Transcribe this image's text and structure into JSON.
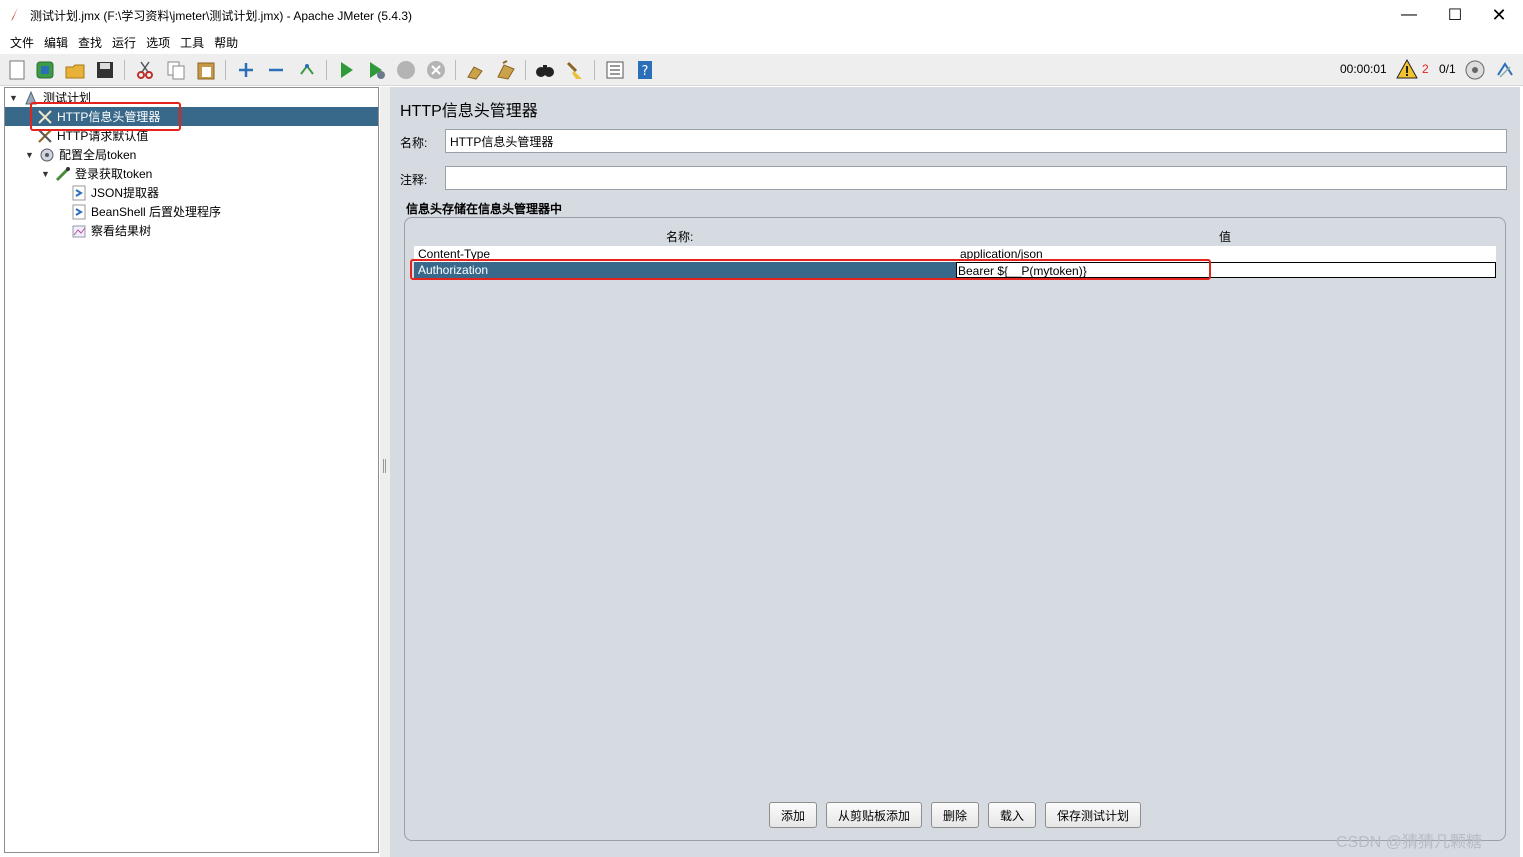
{
  "window": {
    "title": "测试计划.jmx (F:\\学习资料\\jmeter\\测试计划.jmx) - Apache JMeter (5.4.3)",
    "minimize_glyph": "—",
    "maximize_glyph": "☐",
    "close_glyph": "✕"
  },
  "menu": [
    "文件",
    "编辑",
    "查找",
    "运行",
    "选项",
    "工具",
    "帮助"
  ],
  "toolbar": {
    "icons": [
      "new-icon",
      "templates-icon",
      "open-icon",
      "save-icon",
      "cut-icon",
      "copy-icon",
      "paste-icon",
      "expand-icon",
      "collapse-icon",
      "toggle-icon",
      "start-icon",
      "start-no-pause-icon",
      "stop-icon",
      "shutdown-icon",
      "clear-icon",
      "clear-all-icon",
      "search-icon",
      "reset-search-icon",
      "function-helper-icon",
      "help-icon"
    ],
    "timer": "00:00:01",
    "warning_count": "2",
    "threads": "0/1"
  },
  "tree": {
    "items": [
      {
        "label": "测试计划",
        "icon": "test-plan-icon",
        "toggle": "▼"
      },
      {
        "label": "HTTP信息头管理器",
        "icon": "wrench-icon"
      },
      {
        "label": "HTTP请求默认值",
        "icon": "wrench-icon"
      },
      {
        "label": "配置全局token",
        "icon": "gear-icon",
        "toggle": "▼"
      },
      {
        "label": "登录获取token",
        "icon": "pipette-icon",
        "toggle": "▼"
      },
      {
        "label": "JSON提取器",
        "icon": "post-processor-icon"
      },
      {
        "label": "BeanShell 后置处理程序",
        "icon": "post-processor-icon"
      },
      {
        "label": "察看结果树",
        "icon": "listener-icon"
      }
    ]
  },
  "editor": {
    "title": "HTTP信息头管理器",
    "name_label": "名称:",
    "name_value": "HTTP信息头管理器",
    "comment_label": "注释:",
    "comment_value": "",
    "group_title": "信息头存储在信息头管理器中",
    "columns": [
      "名称:",
      "值"
    ],
    "rows": [
      {
        "name": "Content-Type",
        "value": "application/json"
      },
      {
        "name": "Authorization",
        "value": "Bearer ${__P(mytoken)}"
      }
    ],
    "buttons": [
      "添加",
      "从剪贴板添加",
      "删除",
      "载入",
      "保存测试计划"
    ]
  },
  "watermark": "CSDN @猜猜几颗糖",
  "colors": {
    "selection": "#39698a",
    "panel_bg": "#d6dae1",
    "highlight_border": "#e5231d",
    "warning": "#e5231d"
  }
}
